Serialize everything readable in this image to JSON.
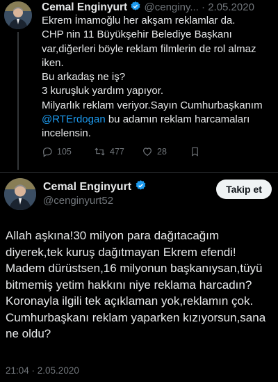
{
  "reply_tweet": {
    "author_name": "Cemal Enginyurt",
    "author_handle": "@cenginy...",
    "separator": "·",
    "date": "2.05.2020",
    "text_lines": [
      "Ekrem İmamoğlu her akşam reklamlar da.",
      "CHP nin 11 Büyükşehir Belediye Başkanı",
      "var,diğerleri böyle reklam filmlerin de rol almaz",
      "iken.",
      "Bu arkadaş ne iş?",
      "3 kuruşluk yardım yapıyor.",
      "Milyarlık reklam veriyor.Sayın Cumhurbaşkanım"
    ],
    "mention": "@RTErdogan",
    "after_mention": " bu adamın reklam harcamaları",
    "last_line": "incelensin.",
    "actions": {
      "replies": "105",
      "retweets": "477",
      "likes": "28"
    }
  },
  "main_tweet": {
    "author_name": "Cemal Enginyurt",
    "author_handle": "@cenginyurt52",
    "follow_label": "Takip et",
    "text_lines": [
      "Allah aşkına!30 milyon para dağıtacağım",
      "diyerek,tek kuruş dağıtmayan Ekrem efendi!",
      "Madem dürüstsen,16 milyonun başkanıysan,tüyü",
      "bitmemiş yetim hakkını niye reklama harcadın?",
      "Koronayla ilgili tek açıklaman yok,reklamın çok.",
      "Cumhurbaşkanı reklam yaparken kızıyorsun,sana",
      "ne oldu?"
    ],
    "timestamp": "21:04 · 2.05.2020"
  },
  "colors": {
    "background": "#000000",
    "text": "#e7e9ea",
    "muted": "#71767b",
    "link": "#1d9bf0",
    "verified": "#1d9bf0"
  },
  "icons": [
    "reply-icon",
    "retweet-icon",
    "like-icon",
    "bookmark-icon",
    "verified-badge-icon"
  ]
}
